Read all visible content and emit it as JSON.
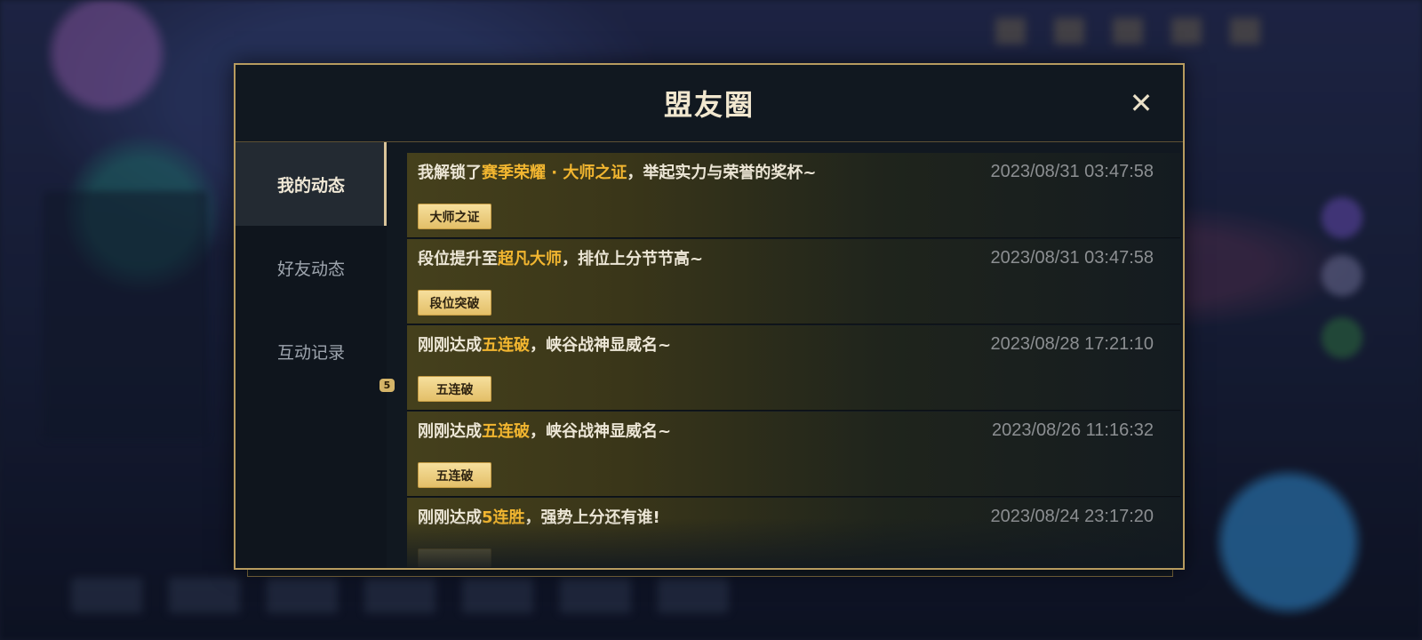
{
  "dialog": {
    "title": "盟友圈",
    "close_label": "✕"
  },
  "tabs": [
    {
      "label": "我的动态",
      "active": true
    },
    {
      "label": "好友动态",
      "active": false
    },
    {
      "label": "互动记录",
      "active": false,
      "badge": "5"
    }
  ],
  "feed": [
    {
      "prefix": "我解锁了",
      "highlight": "赛季荣耀 · 大师之证",
      "suffix": "，举起实力与荣誉的奖杯~",
      "time": "2023/08/31 03:47:58",
      "tag": "大师之证"
    },
    {
      "prefix": "段位提升至",
      "highlight": "超凡大师",
      "suffix": "，排位上分节节高~",
      "time": "2023/08/31 03:47:58",
      "tag": "段位突破"
    },
    {
      "prefix": "刚刚达成",
      "highlight": "五连破",
      "suffix": "，峡谷战神显威名~",
      "time": "2023/08/28 17:21:10",
      "tag": "五连破"
    },
    {
      "prefix": "刚刚达成",
      "highlight": "五连破",
      "suffix": "，峡谷战神显威名~",
      "time": "2023/08/26 11:16:32",
      "tag": "五连破"
    },
    {
      "prefix": "刚刚达成",
      "highlight": "5连胜",
      "suffix": "，强势上分还有谁!",
      "time": "2023/08/24 23:17:20",
      "tag": ""
    }
  ],
  "colors": {
    "highlight": "#f2b630",
    "gold_border": "#b79b5f",
    "tag_bg": "#e3bf68"
  }
}
